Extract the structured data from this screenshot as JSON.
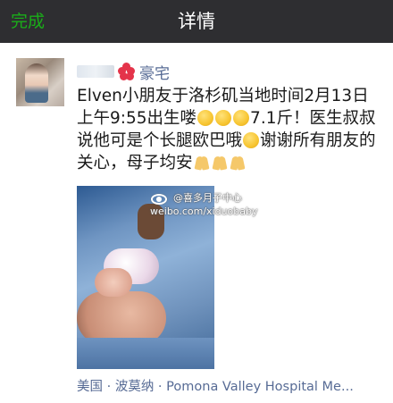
{
  "navbar": {
    "done_label": "完成",
    "title": "详情"
  },
  "post": {
    "username": "豪宅",
    "text_1": "Elven小朋友于洛杉矶当地时间2月13日上午9:55出生喽",
    "text_2": "7.1斤！医生叔叔说他可是个长腿欧巴哦",
    "text_3": "谢谢所有朋友的关心，母子均安",
    "emojis_after_text_1": [
      "surprised-face",
      "surprised-face",
      "surprised-face"
    ],
    "emoji_after_text_2": "thinking-face",
    "emojis_after_text_3": [
      "praying-hands",
      "praying-hands",
      "praying-hands"
    ],
    "photo": {
      "watermark_line1": "@喜多月子中心",
      "watermark_line2": "weibo.com/xiduobaby"
    },
    "location": "美国 · 波莫纳 · Pomona Valley Hospital Me..."
  },
  "colors": {
    "navbar_bg": "#2e2e31",
    "accent_green": "#1aad19",
    "link_blue": "#576b95"
  }
}
